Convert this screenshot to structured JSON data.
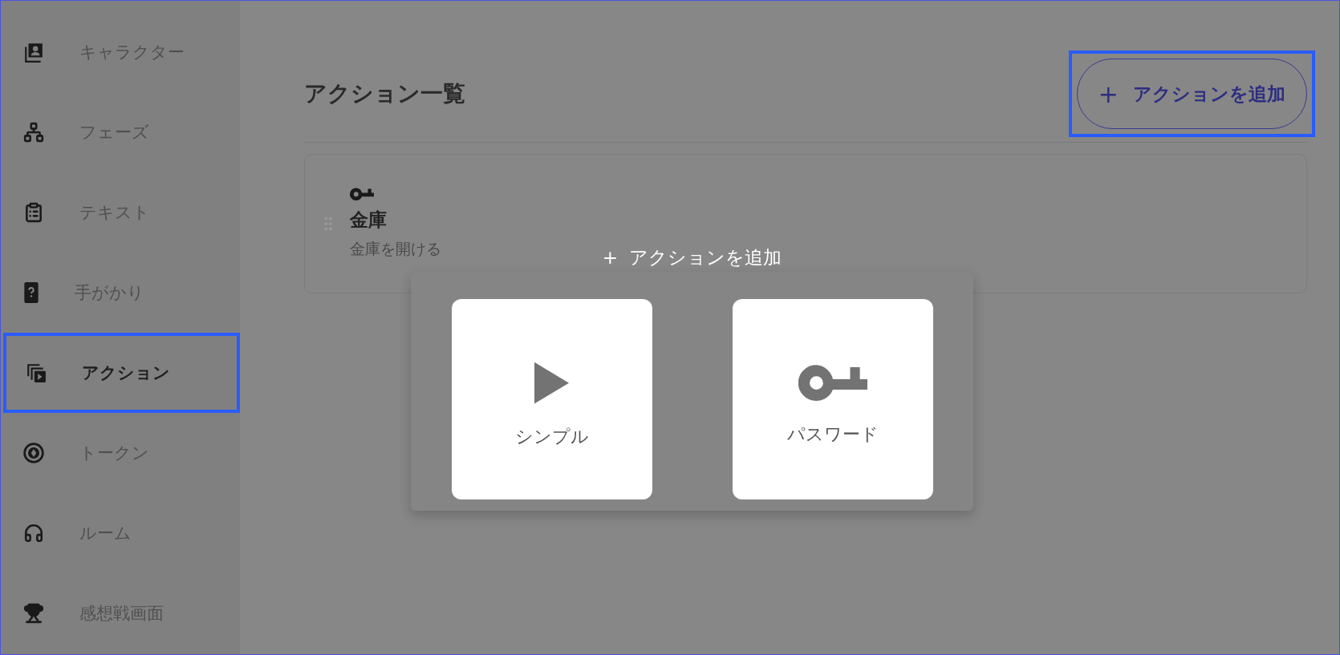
{
  "sidebar": {
    "items": [
      {
        "label": "キャラクター",
        "kind": "character",
        "selected": false,
        "highlighted": false
      },
      {
        "label": "フェーズ",
        "kind": "phase",
        "selected": false,
        "highlighted": false
      },
      {
        "label": "テキスト",
        "kind": "text",
        "selected": false,
        "highlighted": false
      },
      {
        "label": "手がかり",
        "kind": "clue",
        "selected": false,
        "highlighted": false
      },
      {
        "label": "アクション",
        "kind": "action",
        "selected": true,
        "highlighted": true
      },
      {
        "label": "トークン",
        "kind": "token",
        "selected": false,
        "highlighted": false
      },
      {
        "label": "ルーム",
        "kind": "room",
        "selected": false,
        "highlighted": false
      },
      {
        "label": "感想戦画面",
        "kind": "review",
        "selected": false,
        "highlighted": false
      }
    ]
  },
  "page": {
    "title": "アクション一覧",
    "add_button": {
      "icon": "+",
      "label": "アクションを追加",
      "highlighted": true
    }
  },
  "actions": [
    {
      "kind": "password",
      "name": "金庫",
      "description": "金庫を開ける"
    }
  ],
  "dialog": {
    "icon": "+",
    "title": "アクションを追加",
    "options": [
      {
        "kind": "simple",
        "label": "シンプル"
      },
      {
        "kind": "password",
        "label": "パスワード"
      }
    ]
  }
}
